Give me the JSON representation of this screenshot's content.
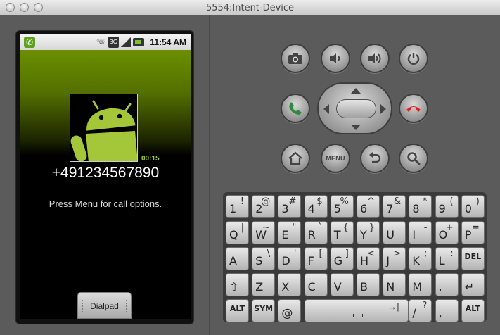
{
  "window": {
    "title": "5554:Intent-Device"
  },
  "statusbar": {
    "time": "11:54 AM",
    "network": "3G"
  },
  "call": {
    "elapsed": "00:15",
    "number": "+491234567890",
    "hint": "Press Menu for call options.",
    "dialpad_label": "Dialpad"
  },
  "hardware": {
    "menu_label": "MENU"
  },
  "keyboard": {
    "rows": [
      [
        {
          "m": "1",
          "a": "!"
        },
        {
          "m": "2",
          "a": "@"
        },
        {
          "m": "3",
          "a": "#"
        },
        {
          "m": "4",
          "a": "$"
        },
        {
          "m": "5",
          "a": "%"
        },
        {
          "m": "6",
          "a": "^"
        },
        {
          "m": "7",
          "a": "&"
        },
        {
          "m": "8",
          "a": "*"
        },
        {
          "m": "9",
          "a": "("
        },
        {
          "m": "0",
          "a": ")"
        }
      ],
      [
        {
          "m": "Q",
          "a": "|"
        },
        {
          "m": "W",
          "a": "~"
        },
        {
          "m": "E",
          "a": "\""
        },
        {
          "m": "R",
          "a": "`"
        },
        {
          "m": "T",
          "a": "{"
        },
        {
          "m": "Y",
          "a": "}"
        },
        {
          "m": "U",
          "a": "_"
        },
        {
          "m": "I",
          "a": "-"
        },
        {
          "m": "O",
          "a": "+"
        },
        {
          "m": "P",
          "a": "="
        }
      ],
      [
        {
          "m": "A",
          "a": ""
        },
        {
          "m": "S",
          "a": "\\"
        },
        {
          "m": "D",
          "a": "'"
        },
        {
          "m": "F",
          "a": "["
        },
        {
          "m": "G",
          "a": "]"
        },
        {
          "m": "H",
          "a": "<"
        },
        {
          "m": "J",
          "a": ">"
        },
        {
          "m": "K",
          "a": ";"
        },
        {
          "m": "L",
          "a": ":"
        },
        {
          "m": "DEL",
          "a": ""
        }
      ],
      [
        {
          "m": "⇧",
          "a": ""
        },
        {
          "m": "Z",
          "a": ""
        },
        {
          "m": "X",
          "a": ""
        },
        {
          "m": "C",
          "a": ""
        },
        {
          "m": "V",
          "a": ""
        },
        {
          "m": "B",
          "a": ""
        },
        {
          "m": "N",
          "a": ""
        },
        {
          "m": "M",
          "a": ""
        },
        {
          "m": ".",
          "a": ""
        },
        {
          "m": "↵",
          "a": ""
        }
      ]
    ],
    "bottom": {
      "alt_left": "ALT",
      "sym": "SYM",
      "at": "@",
      "space_alt": "→|",
      "slash": "/",
      "slash_alt": "?",
      "comma": ",",
      "alt_right": "ALT"
    }
  }
}
